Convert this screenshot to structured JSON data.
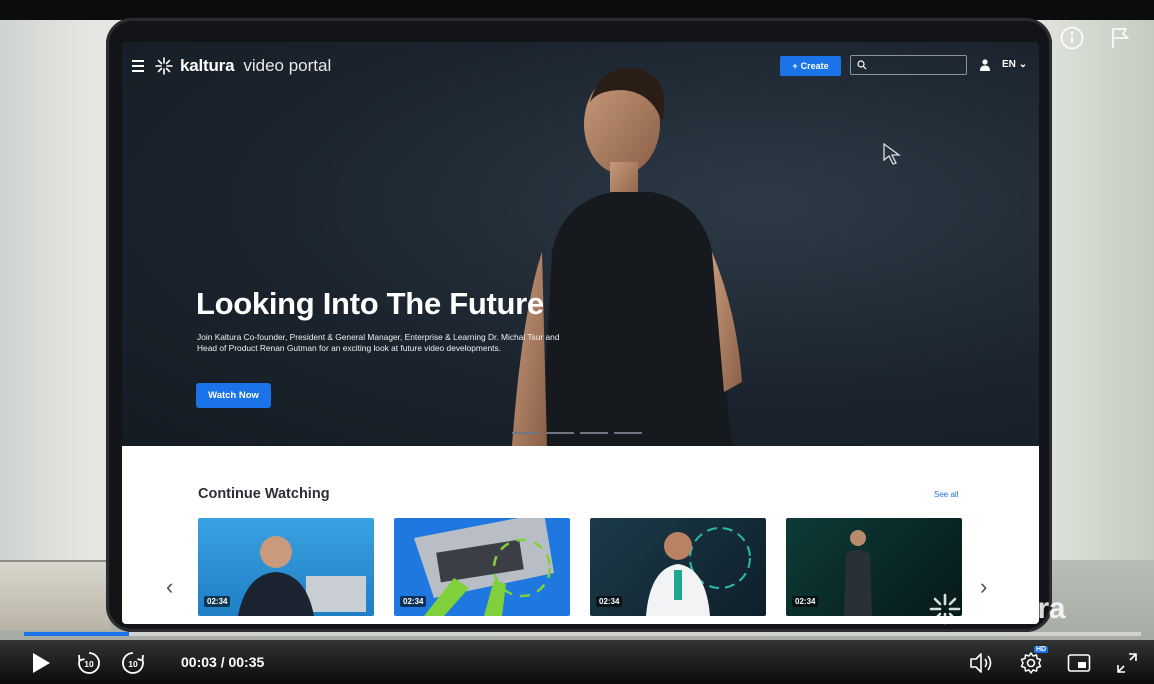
{
  "portal": {
    "brand_bold": "kaltura",
    "brand_light": "video portal",
    "create_label": "Create",
    "language": "EN"
  },
  "hero": {
    "title": "Looking Into The Future",
    "description": "Join Kaltura Co-founder, President & General Manager, Enterprise & Learning Dr. Michal Tsur and Head of Product Renan Gutman for an exciting look at future video developments.",
    "cta": "Watch Now"
  },
  "continue_watching": {
    "title": "Continue Watching",
    "see_all": "See all",
    "cards": [
      {
        "duration": "02:34"
      },
      {
        "duration": "02:34"
      },
      {
        "duration": "02:34"
      },
      {
        "duration": "02:34"
      }
    ]
  },
  "player": {
    "current_time": "00:03",
    "total_time": "00:35",
    "time_display": "00:03 / 00:35",
    "progress_fraction": 0.094,
    "skip_back_label": "10",
    "skip_forward_label": "10",
    "quality_badge": "HD",
    "watermark": "kaltura"
  },
  "icons": [
    "info-icon",
    "flag-icon",
    "play-icon",
    "rewind-10-icon",
    "forward-10-icon",
    "volume-icon",
    "settings-icon",
    "picture-in-picture-icon",
    "fullscreen-icon"
  ],
  "colors": {
    "accent": "#1a73e8",
    "player_bg": "#0b0c0e"
  }
}
